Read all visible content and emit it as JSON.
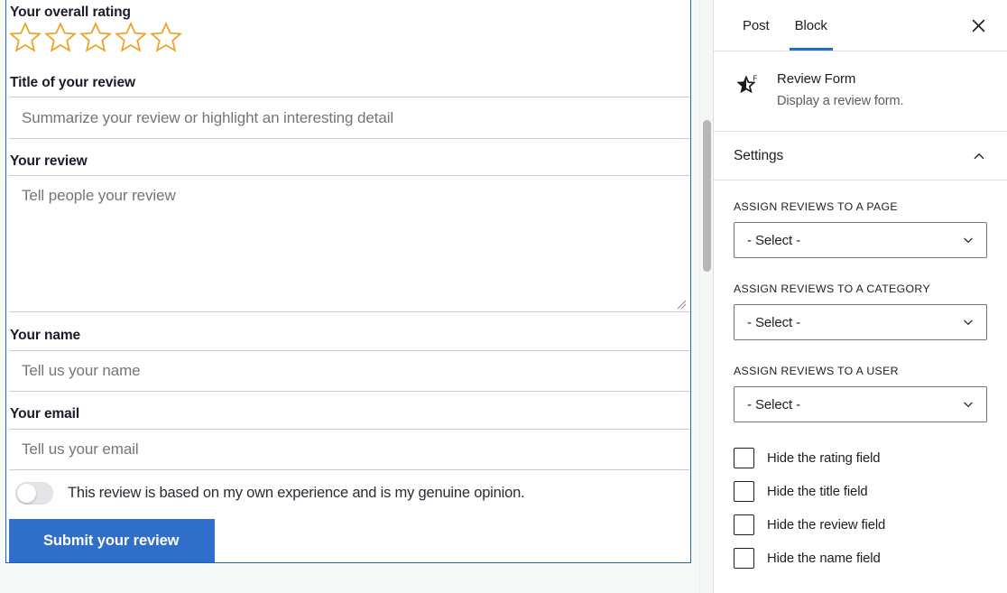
{
  "editor": {
    "form": {
      "rating_label": "Your overall rating",
      "rating_stars": 5,
      "rating_value": 0,
      "star_color": "#eda221",
      "title_label": "Title of your review",
      "title_placeholder": "Summarize your review or highlight an interesting detail",
      "title_value": "",
      "review_label": "Your review",
      "review_placeholder": "Tell people your review",
      "review_value": "",
      "name_label": "Your name",
      "name_placeholder": "Tell us your name",
      "name_value": "",
      "email_label": "Your email",
      "email_placeholder": "Tell us your email",
      "email_value": "",
      "terms_text": "This review is based on my own experience and is my genuine opinion.",
      "terms_checked": false,
      "submit_label": "Submit your review",
      "submit_color": "#2f6fca",
      "selection_border_color": "#1d62c4"
    }
  },
  "sidebar": {
    "tabs": [
      {
        "label": "Post",
        "active": false
      },
      {
        "label": "Block",
        "active": true
      }
    ],
    "close_label": "Close settings",
    "block": {
      "icon": "half-star-f-icon",
      "title": "Review Form",
      "description": "Display a review form."
    },
    "panel": {
      "title": "Settings",
      "expanded": true,
      "controls": [
        {
          "label": "ASSIGN REVIEWS TO A PAGE",
          "value": "- Select -"
        },
        {
          "label": "ASSIGN REVIEWS TO A CATEGORY",
          "value": "- Select -"
        },
        {
          "label": "ASSIGN REVIEWS TO A USER",
          "value": "- Select -"
        }
      ],
      "checkboxes": [
        {
          "label": "Hide the rating field",
          "checked": false
        },
        {
          "label": "Hide the title field",
          "checked": false
        },
        {
          "label": "Hide the review field",
          "checked": false
        },
        {
          "label": "Hide the name field",
          "checked": false
        }
      ]
    },
    "accent_color": "#1f6fd0"
  }
}
